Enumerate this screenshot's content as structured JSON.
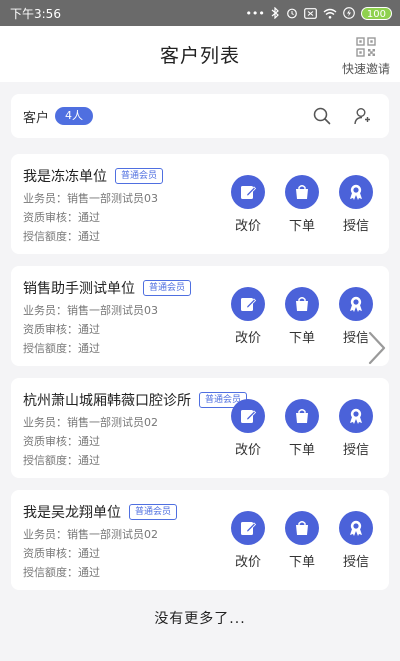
{
  "status": {
    "time": "下午3:56",
    "battery": "100",
    "dots": "•••"
  },
  "nav": {
    "title": "客户列表",
    "invite_label": "快速邀请"
  },
  "summary": {
    "label": "客户",
    "count": "4人"
  },
  "customers": [
    {
      "name": "我是冻冻单位",
      "tag": "普通会员",
      "sales": "业务员：销售一部测试员03",
      "review": "资质审核：通过",
      "credit": "授信额度：通过"
    },
    {
      "name": "销售助手测试单位",
      "tag": "普通会员",
      "sales": "业务员：销售一部测试员03",
      "review": "资质审核：通过",
      "credit": "授信额度：通过"
    },
    {
      "name": "杭州萧山城厢韩薇口腔诊所",
      "tag": "普通会员",
      "sales": "业务员：销售一部测试员02",
      "review": "资质审核：通过",
      "credit": "授信额度：通过"
    },
    {
      "name": "我是吴龙翔单位",
      "tag": "普通会员",
      "sales": "业务员：销售一部测试员02",
      "review": "资质审核：通过",
      "credit": "授信额度：通过"
    }
  ],
  "actions": {
    "edit_price": "改价",
    "order": "下单",
    "credit": "授信"
  },
  "footer": {
    "text": "没有更多了..."
  },
  "colors": {
    "accent": "#4b62d9",
    "badge": "#4f6fe0"
  }
}
